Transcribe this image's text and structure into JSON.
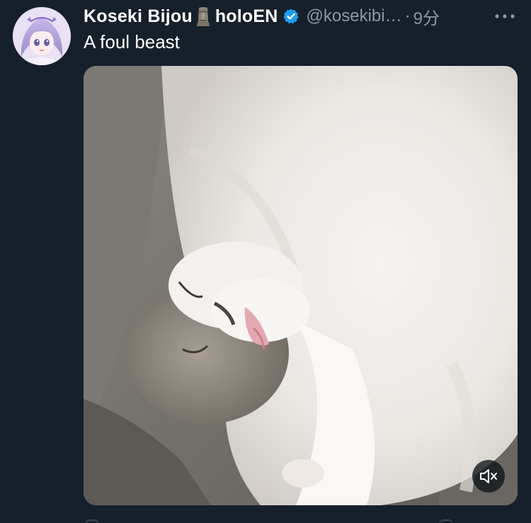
{
  "tweet": {
    "display_name": "Koseki Bijou",
    "name_emoji": "moai-icon",
    "affiliation": "holoEN",
    "verified": true,
    "handle": "@kosekibi…",
    "separator": "·",
    "time": "9分",
    "text": "A foul beast"
  },
  "media": {
    "type": "video",
    "audio_state": "muted",
    "mute_icon": "speaker-muted-icon"
  },
  "colors": {
    "background": "#15202b",
    "text_primary": "#ffffff",
    "text_secondary": "#8b98a5",
    "verified_badge": "#1d9bf0"
  }
}
